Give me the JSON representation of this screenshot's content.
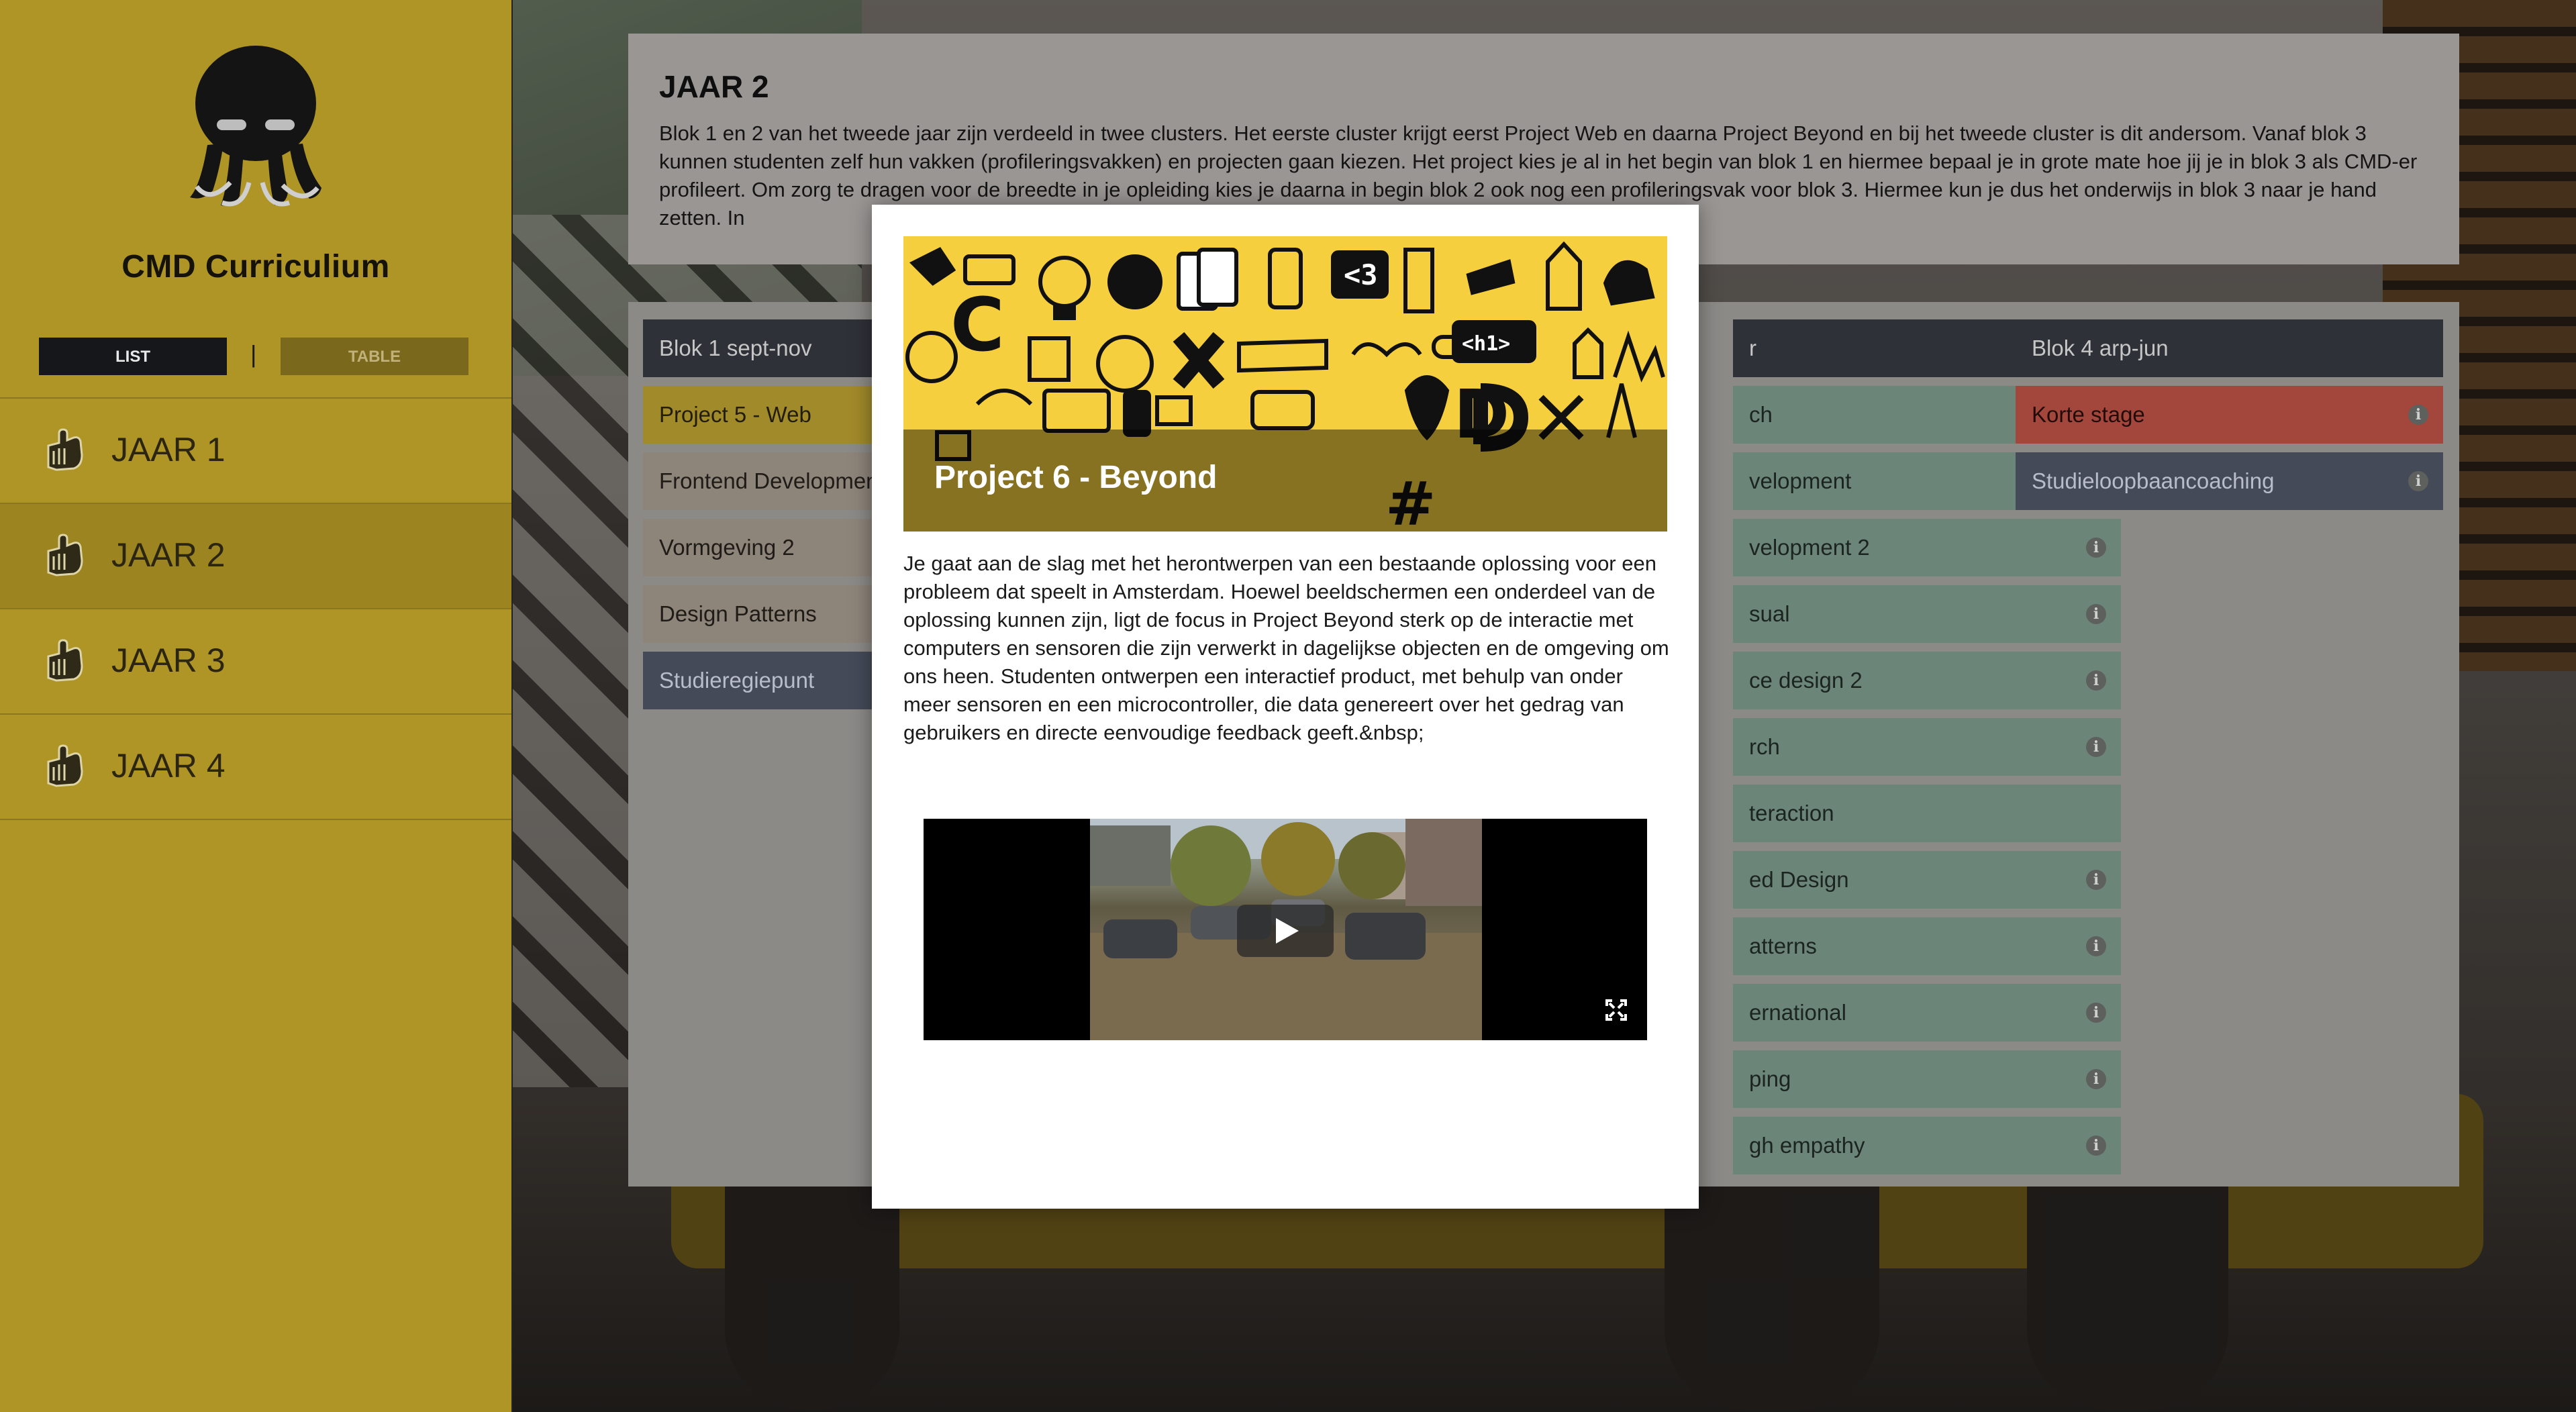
{
  "sidebar": {
    "app_title": "CMD Curriculium",
    "view_toggle": {
      "list_label": "LIST",
      "separator": "|",
      "table_label": "TABLE"
    },
    "years": [
      {
        "label": "JAAR 1",
        "active": false
      },
      {
        "label": "JAAR 2",
        "active": true
      },
      {
        "label": "JAAR 3",
        "active": false
      },
      {
        "label": "JAAR 4",
        "active": false
      }
    ]
  },
  "intro": {
    "title": "JAAR 2",
    "text": "Blok 1 en 2 van het tweede jaar zijn verdeeld in twee clusters. Het eerste cluster krijgt eerst Project Web en daarna Project Beyond en bij het tweede cluster is dit andersom. Vanaf blok 3 kunnen studenten zelf hun vakken (profileringsvakken) en projecten gaan kiezen. Het project kies je al in het begin van blok 1 en hiermee bepaal je in grote mate hoe jij je in blok 3 als CMD-er profileert. Om zorg te dragen voor de breedte in je opleiding kies je daarna in begin blok 2 ook nog een profileringsvak voor blok 3. Hiermee kun je dus het onderwijs in blok 3 naar je hand zetten. In"
  },
  "columns": [
    {
      "header": "Blok 1 sept-nov",
      "cells": [
        {
          "label": "Project 5 - Web",
          "color": "yellow",
          "info": false
        },
        {
          "label": "Frontend Developmen",
          "color": "beige",
          "info": false
        },
        {
          "label": "Vormgeving 2",
          "color": "beige",
          "info": false
        },
        {
          "label": "Design Patterns",
          "color": "beige",
          "info": false
        },
        {
          "label": "Studieregiepunt",
          "color": "slate",
          "info": false
        }
      ]
    },
    {
      "header": "r",
      "cells": [
        {
          "label": "ch",
          "color": "green",
          "info": false
        },
        {
          "label": "velopment",
          "color": "green",
          "info": false
        },
        {
          "label": "velopment 2",
          "color": "green",
          "info": true
        },
        {
          "label": "sual",
          "color": "green",
          "info": true
        },
        {
          "label": "ce design 2",
          "color": "green",
          "info": true
        },
        {
          "label": "rch",
          "color": "green",
          "info": true
        },
        {
          "label": "teraction",
          "color": "green",
          "info": false
        },
        {
          "label": "ed Design",
          "color": "green",
          "info": true
        },
        {
          "label": "atterns",
          "color": "green",
          "info": true
        },
        {
          "label": "ernational",
          "color": "green",
          "info": true
        },
        {
          "label": "ping",
          "color": "green",
          "info": true
        },
        {
          "label": "gh empathy",
          "color": "green",
          "info": true
        }
      ]
    },
    {
      "header": "Blok 4 arp-jun",
      "cells": [
        {
          "label": "Korte stage",
          "color": "red",
          "info": true
        },
        {
          "label": "Studieloopbaancoaching",
          "color": "slate",
          "info": true
        }
      ]
    }
  ],
  "info_glyph": "i",
  "modal": {
    "title": "Project 6 - Beyond",
    "text": "Je gaat aan de slag met het herontwerpen van een bestaande oplossing voor een probleem dat speelt in Amsterdam. Hoewel beeldschermen een onderdeel van de oplossing kunnen zijn, ligt de focus in Project Beyond sterk op de interactie met computers en sensoren die zijn verwerkt in dagelijkse objecten en de omgeving om ons heen. Studenten ontwerpen een interactief product, met behulp van onder meer sensoren en een microcontroller, die data genereert over het gedrag van gebruikers en directe eenvoudige feedback geeft.&nbsp;",
    "banner_glyphs": [
      "<3",
      "<h1>",
      "#",
      "C",
      "D"
    ],
    "video": {
      "play_icon": "play-icon",
      "fullscreen_icon": "fullscreen-icon"
    }
  },
  "colors": {
    "sidebar": "#af9526",
    "accent_dark": "#15171b",
    "banner_yellow": "#f6cf3e",
    "cell_green": "#6b8679",
    "cell_red": "#a3473c",
    "cell_slate": "#454a59"
  }
}
